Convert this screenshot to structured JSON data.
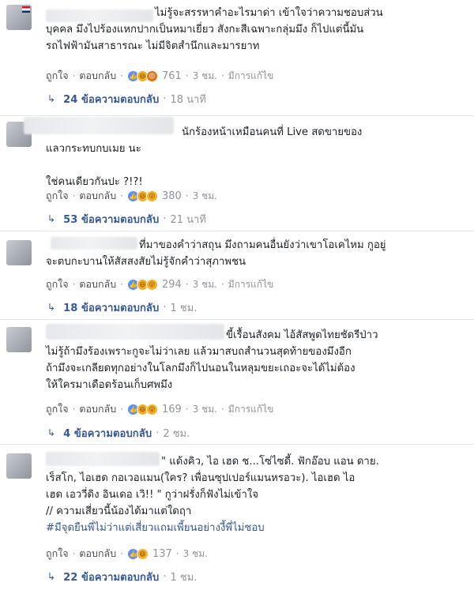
{
  "comments": [
    {
      "text": "ไม่รู้จะสรรหาคำอะไรมาด่า เข้าใจว่าความชอบส่วน\nบุคคล มึงไปร้องแหกปากเป็นหมาเยี่ยว สังกะสีเฉพาะกลุ่มมึง ก็ไปแต่นี้มัน\nรถไฟฟ้ามันสาธารณะ ไม่มีจิตสำนึกและมารยาท",
      "like": "ถูกใจ",
      "reply": "ตอบกลับ",
      "reactions": [
        "like",
        "haha",
        "angry"
      ],
      "count": "761",
      "time": "3 ชม.",
      "edited": "มีการแก้ไข",
      "replies": "24 ข้อความตอบกลับ",
      "replies_time": "18 นาที"
    },
    {
      "text": "นักร้องหน้าเหมือนคนที่ Live สดขายของ\nแลวกระทบกบเมย นะ\n\nใช่คนเดียวกันปะ ?!?!",
      "like": "ถูกใจ",
      "reply": "ตอบกลับ",
      "reactions": [
        "like",
        "haha",
        "wow"
      ],
      "count": "380",
      "time": "3 ชม.",
      "edited": "",
      "replies": "53 ข้อความตอบกลับ",
      "replies_time": "21 นาที"
    },
    {
      "text": "ที่มาของคำว่าสถุน มึงถามคนอื่นยังว่าเขาโอเคไหม กูอยู่\nจะตบกะบานให้สัสสงสัยไม่รู้จักคำว่าสุภาพชน",
      "like": "ถูกใจ",
      "reply": "ตอบกลับ",
      "reactions": [
        "like",
        "haha",
        "wow"
      ],
      "count": "294",
      "time": "3 ชม.",
      "edited": "มีการแก้ไข",
      "replies": "18 ข้อความตอบกลับ",
      "replies_time": "1 ชม."
    },
    {
      "text": "ขี้เรื้อนสังคม ไอ้สัสพูดไทยชัดรีป่าว\nไม่รู้ถ้ามึงร้องเพราะกูจะไม่ว่าเลย แล้วมาสบถสำนวนสุดท้ายของมึงอีก\nถ้ามึงจะเกลียดทุกอย่างในโลกมึงก็ไปนอนในหลุมขยะเถอะจะได้ไม่ต้อง\nให้ใครมาเดือดร้อนเก็บศพมึง",
      "like": "ถูกใจ",
      "reply": "ตอบกลับ",
      "reactions": [
        "like",
        "haha",
        "wow"
      ],
      "count": "169",
      "time": "3 ชม.",
      "edited": "มีการแก้ไข",
      "replies": "4 ข้อความตอบกลับ",
      "replies_time": "2 ชม."
    },
    {
      "text": "\" แด้งคิว, ไอ เฮด ช...โซ่ไซดี้. ฟักอ๊อบ แอน ดาย.\nเร็สโก, ไอเฮด กอเวอแมน(ใคร? เพื่อนซุปเปอร์แมนหรอวะ). ไอเฮด ไอ\nเฮด เอววี่ดิง อินเดอ เวิ!! \" กูว่าฝรั่งก็ฟังไม่เข้าใจ\n// ความเสี่ยวนี้น้องได้มาแต่ใดฤา",
      "hashtag": "#มีจุดยืนพี่ไม่ว่าแต่เสี่ยวแถมเพี้ยนอย่างงี้พี่ไม่ชอบ",
      "like": "ถูกใจ",
      "reply": "ตอบกลับ",
      "reactions": [
        "like",
        "haha"
      ],
      "count": "137",
      "time": "3 ชม.",
      "edited": "",
      "replies": "22 ข้อความตอบกลับ",
      "replies_time": "1 ชม."
    }
  ],
  "colors": {
    "link": "#365899",
    "meta": "#90949c",
    "text": "#1d2129",
    "like_reaction": "#5890ff",
    "haha_reaction": "#f7b125"
  }
}
